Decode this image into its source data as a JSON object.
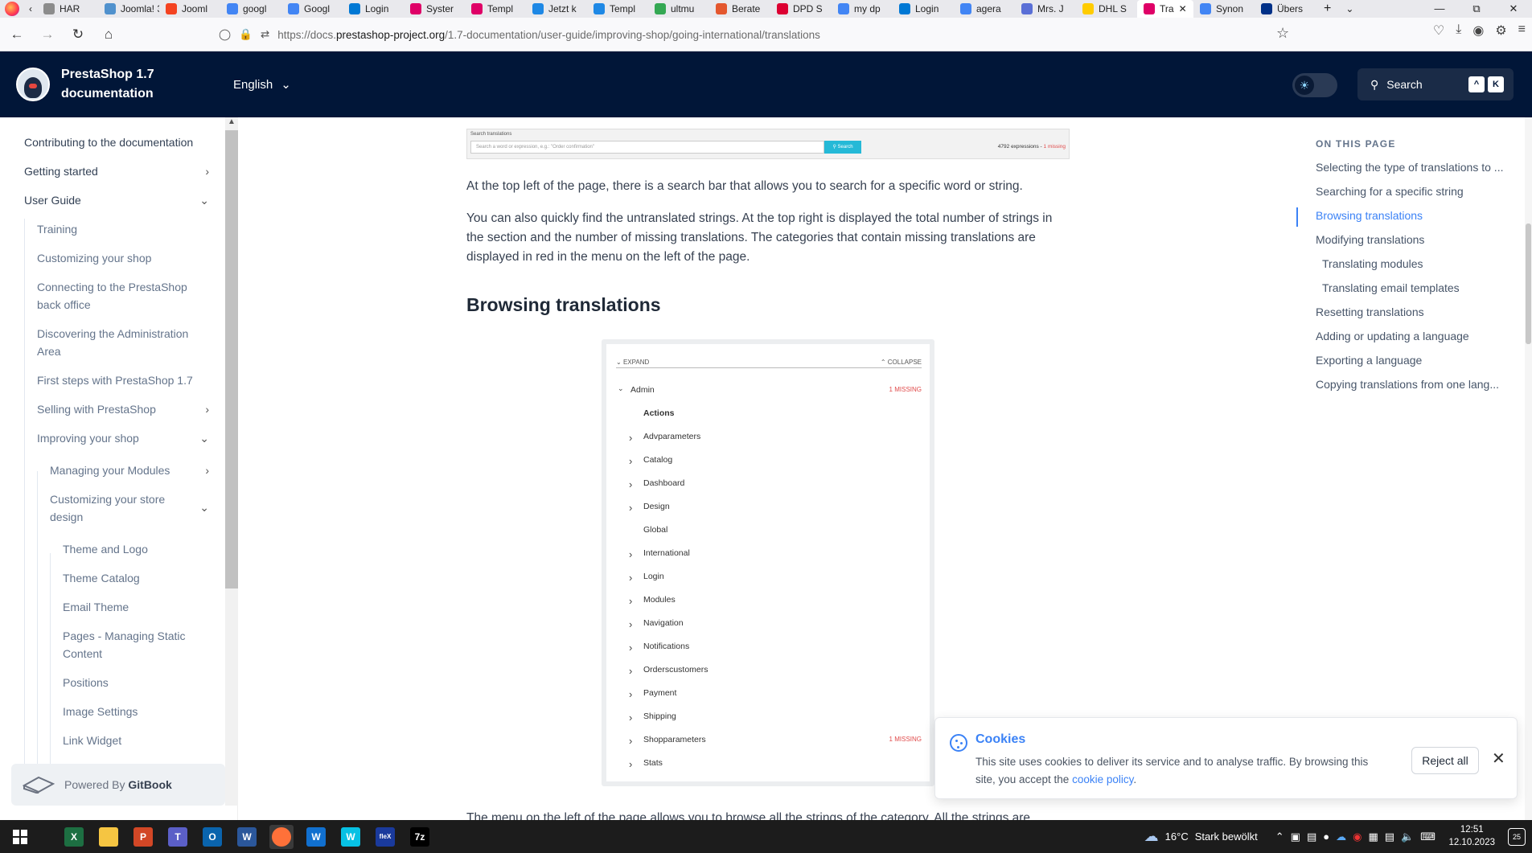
{
  "browser": {
    "tabs": [
      {
        "label": "HAR",
        "color": "#8c8c8c"
      },
      {
        "label": "Joomla! 3",
        "color": "#5091cd"
      },
      {
        "label": "Jooml",
        "color": "#f44321"
      },
      {
        "label": "googl",
        "color": "#4285f4"
      },
      {
        "label": "Googl",
        "color": "#4285f4"
      },
      {
        "label": "Login",
        "color": "#0078d4"
      },
      {
        "label": "Syster",
        "color": "#df0067"
      },
      {
        "label": "Templ",
        "color": "#df0067"
      },
      {
        "label": "Jetzt k",
        "color": "#1e88e5"
      },
      {
        "label": "Templ",
        "color": "#1e88e5"
      },
      {
        "label": "ultmu",
        "color": "#34a853"
      },
      {
        "label": "Berate",
        "color": "#e4572e"
      },
      {
        "label": "DPD S",
        "color": "#dc0032"
      },
      {
        "label": "my dp",
        "color": "#4285f4"
      },
      {
        "label": "Login",
        "color": "#0078d4"
      },
      {
        "label": "agera",
        "color": "#4285f4"
      },
      {
        "label": "Mrs. J",
        "color": "#5a6fd6"
      },
      {
        "label": "DHL S",
        "color": "#ffcc00"
      },
      {
        "label": "Tra",
        "color": "#df0067"
      },
      {
        "label": "Synon",
        "color": "#4285f4"
      },
      {
        "label": "Übers",
        "color": "#003087"
      }
    ],
    "active_tab_index": 18,
    "url_prefix": "https://docs.",
    "url_domain": "prestashop-project.org",
    "url_path": "/1.7-documentation/user-guide/improving-shop/going-international/translations"
  },
  "header": {
    "title": "PrestaShop 1.7 documentation",
    "language": "English",
    "search_label": "Search",
    "kbd1": "^",
    "kbd2": "K"
  },
  "sidebar": {
    "items": [
      {
        "label": "Contributing to the documentation"
      },
      {
        "label": "Getting started"
      },
      {
        "label": "User Guide"
      },
      {
        "label": "Training"
      },
      {
        "label": "Customizing your shop"
      },
      {
        "label": "Connecting to the PrestaShop back office"
      },
      {
        "label": "Discovering the Administration Area"
      },
      {
        "label": "First steps with PrestaShop 1.7"
      },
      {
        "label": "Selling with PrestaShop"
      },
      {
        "label": "Improving your shop"
      },
      {
        "label": "Managing your Modules"
      },
      {
        "label": "Customizing your store design"
      },
      {
        "label": "Theme and Logo"
      },
      {
        "label": "Theme Catalog"
      },
      {
        "label": "Email Theme"
      },
      {
        "label": "Pages - Managing Static Content"
      },
      {
        "label": "Positions"
      },
      {
        "label": "Image Settings"
      },
      {
        "label": "Link Widget"
      }
    ],
    "powered_prefix": "Powered By",
    "powered_brand": "GitBook"
  },
  "search_figure": {
    "label": "Search translations",
    "placeholder": "Search a word or expression, e.g.: \"Order confirmation\"",
    "button": "Search",
    "count": "4792 expressions -",
    "missing": "1 missing"
  },
  "main": {
    "p1": "At the top left of the page, there is a search bar that allows you to search for a specific word or string.",
    "p2": "You can also quickly find the untranslated strings. At the top right is displayed the total number of strings in the section and the number of missing translations. The categories that contain missing translations are displayed in red in the menu on the left of the page.",
    "heading": "Browsing translations",
    "p3": "The menu on the left of the page allows you to browse all the strings of the category. All the strings are"
  },
  "tree_figure": {
    "expand": "EXPAND",
    "collapse": "COLLAPSE",
    "root": "Admin",
    "root_missing": "1 MISSING",
    "rows": [
      {
        "label": "Actions"
      },
      {
        "label": "Advparameters"
      },
      {
        "label": "Catalog"
      },
      {
        "label": "Dashboard"
      },
      {
        "label": "Design"
      },
      {
        "label": "Global"
      },
      {
        "label": "International"
      },
      {
        "label": "Login"
      },
      {
        "label": "Modules"
      },
      {
        "label": "Navigation"
      },
      {
        "label": "Notifications"
      },
      {
        "label": "Orderscustomers"
      },
      {
        "label": "Payment"
      },
      {
        "label": "Shipping"
      },
      {
        "label": "Shopparameters",
        "missing": "1 MISSING"
      },
      {
        "label": "Stats"
      }
    ]
  },
  "toc": {
    "title": "ON THIS PAGE",
    "items": [
      {
        "label": "Selecting the type of translations to ..."
      },
      {
        "label": "Searching for a specific string"
      },
      {
        "label": "Browsing translations",
        "active": true
      },
      {
        "label": "Modifying translations"
      },
      {
        "label": "Translating modules",
        "sub": true
      },
      {
        "label": "Translating email templates",
        "sub": true
      },
      {
        "label": "Resetting translations"
      },
      {
        "label": "Adding or updating a language"
      },
      {
        "label": "Exporting a language"
      },
      {
        "label": "Copying translations from one lang..."
      }
    ]
  },
  "cookie": {
    "title": "Cookies",
    "text_before": "This site uses cookies to deliver its service and to analyse traffic. By browsing this site, you accept the",
    "link": "cookie policy",
    "text_after": ".",
    "reject": "Reject all"
  },
  "taskbar": {
    "weather_temp": "16°C",
    "weather_desc": "Stark bewölkt",
    "time": "12:51",
    "date": "12.10.2023",
    "notif_count": "25",
    "apps": [
      {
        "name": "excel-icon",
        "glyph": "X",
        "color": "#1d6f42"
      },
      {
        "name": "file-explorer-icon",
        "glyph": "",
        "color": "#f5c542"
      },
      {
        "name": "powerpoint-icon",
        "glyph": "P",
        "color": "#d24726"
      },
      {
        "name": "teams-icon",
        "glyph": "T",
        "color": "#5b5fc7"
      },
      {
        "name": "outlook-icon",
        "glyph": "O",
        "color": "#0a64ad"
      },
      {
        "name": "word-icon",
        "glyph": "W",
        "color": "#2b579a"
      },
      {
        "name": "firefox-icon",
        "glyph": "",
        "color": "#ff7139"
      },
      {
        "name": "webex-icon",
        "glyph": "W",
        "color": "#1170cf"
      },
      {
        "name": "webex-meetings-icon",
        "glyph": "W",
        "color": "#07c1e4"
      },
      {
        "name": "flex-icon",
        "glyph": "fleX",
        "color": "#1a3a9c"
      },
      {
        "name": "7zip-icon",
        "glyph": "7z",
        "color": "#000000"
      }
    ]
  }
}
